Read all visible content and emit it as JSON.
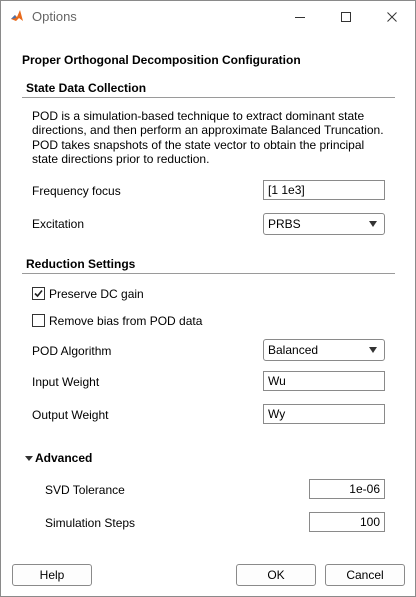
{
  "window": {
    "title": "Options",
    "controls": {
      "minimize_icon": "minimize-icon",
      "maximize_icon": "maximize-icon",
      "close_icon": "close-icon"
    }
  },
  "main_title": "Proper Orthogonal Decomposition Configuration",
  "state_data": {
    "section_title": "State Data Collection",
    "description": "POD is a simulation-based technique to extract dominant state directions, and then perform an approximate Balanced Truncation. POD takes snapshots of the state vector to obtain the principal state directions prior to reduction.",
    "frequency_focus_label": "Frequency focus",
    "frequency_focus_value": "[1 1e3]",
    "excitation_label": "Excitation",
    "excitation_value": "PRBS"
  },
  "reduction": {
    "section_title": "Reduction Settings",
    "preserve_dc_label": "Preserve DC gain",
    "preserve_dc_checked": true,
    "remove_bias_label": "Remove bias from POD data",
    "remove_bias_checked": false,
    "pod_algorithm_label": "POD Algorithm",
    "pod_algorithm_value": "Balanced",
    "input_weight_label": "Input Weight",
    "input_weight_value": "Wu",
    "output_weight_label": "Output Weight",
    "output_weight_value": "Wy"
  },
  "advanced": {
    "section_title": "Advanced",
    "expanded": true,
    "svd_tolerance_label": "SVD Tolerance",
    "svd_tolerance_value": "1e-06",
    "simulation_steps_label": "Simulation Steps",
    "simulation_steps_value": "100"
  },
  "buttons": {
    "help": "Help",
    "ok": "OK",
    "cancel": "Cancel"
  },
  "colors": {
    "checkmark": "#222222",
    "rule": "#9a9a9a",
    "title_text": "#666666"
  }
}
